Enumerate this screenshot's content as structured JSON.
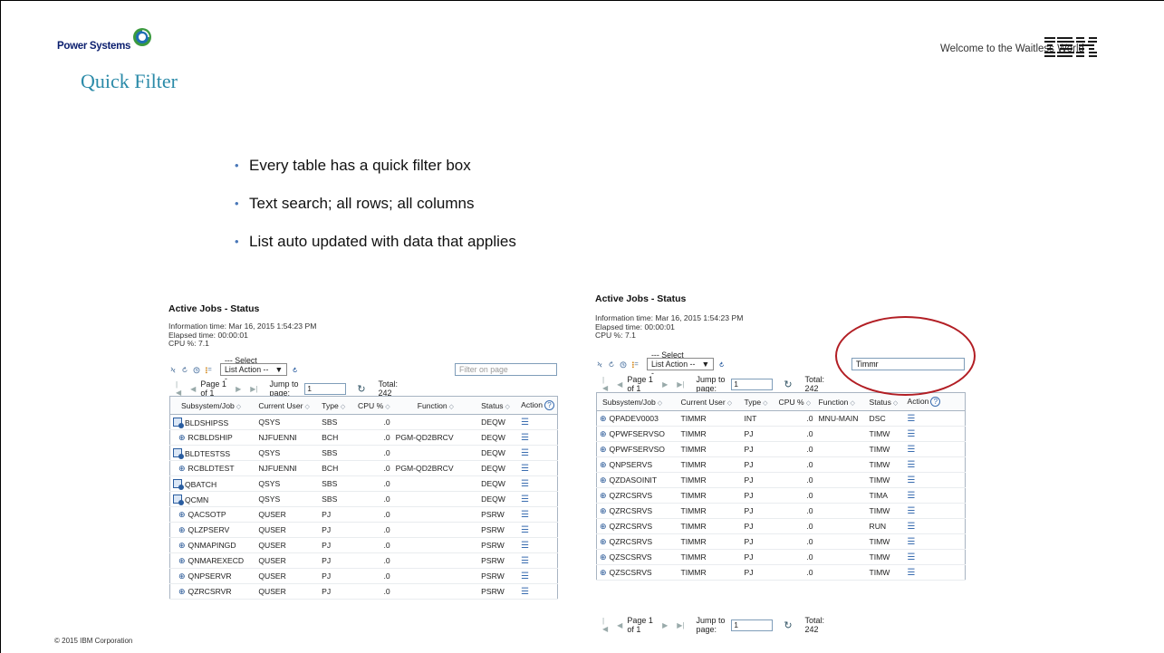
{
  "header": {
    "brand": "Power Systems",
    "title": "Quick Filter",
    "welcome": "Welcome to the Waitless World",
    "company_logo": "IBM"
  },
  "bullets": [
    "Every table has a quick filter box",
    "Text search; all rows; all columns",
    "List auto updated with data that applies"
  ],
  "footer": {
    "copyright": "© 2015 IBM Corporation"
  },
  "columns": [
    "Subsystem/Job",
    "Current User",
    "Type",
    "CPU %",
    "Function",
    "Status",
    "Action"
  ],
  "left_panel": {
    "title": "Active Jobs - Status",
    "info_time": "Information time: Mar 16, 2015 1:54:23 PM",
    "elapsed": "Elapsed time: 00:00:01",
    "cpu": "CPU %: 7.1",
    "select_action": "--- Select List Action ---",
    "filter_placeholder": "Filter on page",
    "page_label": "Page 1 of 1",
    "jump_label": "Jump to page:",
    "jump_value": "1",
    "total": "Total: 242",
    "rows": [
      {
        "job": "BLDSHIPSS",
        "user": "QSYS",
        "type": "SBS",
        "cpu": ".0",
        "func": "",
        "status": "DEQW",
        "sbs": true
      },
      {
        "job": "RCBLDSHIP",
        "user": "NJFUENNI",
        "type": "BCH",
        "cpu": ".0",
        "func": "PGM-QD2BRCV",
        "status": "DEQW",
        "sbs": false
      },
      {
        "job": "BLDTESTSS",
        "user": "QSYS",
        "type": "SBS",
        "cpu": ".0",
        "func": "",
        "status": "DEQW",
        "sbs": true
      },
      {
        "job": "RCBLDTEST",
        "user": "NJFUENNI",
        "type": "BCH",
        "cpu": ".0",
        "func": "PGM-QD2BRCV",
        "status": "DEQW",
        "sbs": false
      },
      {
        "job": "QBATCH",
        "user": "QSYS",
        "type": "SBS",
        "cpu": ".0",
        "func": "",
        "status": "DEQW",
        "sbs": true
      },
      {
        "job": "QCMN",
        "user": "QSYS",
        "type": "SBS",
        "cpu": ".0",
        "func": "",
        "status": "DEQW",
        "sbs": true
      },
      {
        "job": "QACSOTP",
        "user": "QUSER",
        "type": "PJ",
        "cpu": ".0",
        "func": "",
        "status": "PSRW",
        "sbs": false
      },
      {
        "job": "QLZPSERV",
        "user": "QUSER",
        "type": "PJ",
        "cpu": ".0",
        "func": "",
        "status": "PSRW",
        "sbs": false
      },
      {
        "job": "QNMAPINGD",
        "user": "QUSER",
        "type": "PJ",
        "cpu": ".0",
        "func": "",
        "status": "PSRW",
        "sbs": false
      },
      {
        "job": "QNMAREXECD",
        "user": "QUSER",
        "type": "PJ",
        "cpu": ".0",
        "func": "",
        "status": "PSRW",
        "sbs": false
      },
      {
        "job": "QNPSERVR",
        "user": "QUSER",
        "type": "PJ",
        "cpu": ".0",
        "func": "",
        "status": "PSRW",
        "sbs": false
      },
      {
        "job": "QZRCSRVR",
        "user": "QUSER",
        "type": "PJ",
        "cpu": ".0",
        "func": "",
        "status": "PSRW",
        "sbs": false
      }
    ]
  },
  "right_panel": {
    "title": "Active Jobs - Status",
    "info_time": "Information time: Mar 16, 2015 1:54:23 PM",
    "elapsed": "Elapsed time: 00:00:01",
    "cpu": "CPU %: 7.1",
    "select_action": "--- Select List Action ---",
    "filter_value": "Timmr",
    "page_label": "Page 1 of 1",
    "jump_label": "Jump to page:",
    "jump_value": "1",
    "total": "Total: 242",
    "rows": [
      {
        "job": "QPADEV0003",
        "user": "TIMMR",
        "type": "INT",
        "cpu": ".0",
        "func": "MNU-MAIN",
        "status": "DSC"
      },
      {
        "job": "QPWFSERVSO",
        "user": "TIMMR",
        "type": "PJ",
        "cpu": ".0",
        "func": "",
        "status": "TIMW"
      },
      {
        "job": "QPWFSERVSO",
        "user": "TIMMR",
        "type": "PJ",
        "cpu": ".0",
        "func": "",
        "status": "TIMW"
      },
      {
        "job": "QNPSERVS",
        "user": "TIMMR",
        "type": "PJ",
        "cpu": ".0",
        "func": "",
        "status": "TIMW"
      },
      {
        "job": "QZDASOINIT",
        "user": "TIMMR",
        "type": "PJ",
        "cpu": ".0",
        "func": "",
        "status": "TIMW"
      },
      {
        "job": "QZRCSRVS",
        "user": "TIMMR",
        "type": "PJ",
        "cpu": ".0",
        "func": "",
        "status": "TIMA"
      },
      {
        "job": "QZRCSRVS",
        "user": "TIMMR",
        "type": "PJ",
        "cpu": ".0",
        "func": "",
        "status": "TIMW"
      },
      {
        "job": "QZRCSRVS",
        "user": "TIMMR",
        "type": "PJ",
        "cpu": ".0",
        "func": "",
        "status": "RUN"
      },
      {
        "job": "QZRCSRVS",
        "user": "TIMMR",
        "type": "PJ",
        "cpu": ".0",
        "func": "",
        "status": "TIMW"
      },
      {
        "job": "QZSCSRVS",
        "user": "TIMMR",
        "type": "PJ",
        "cpu": ".0",
        "func": "",
        "status": "TIMW"
      },
      {
        "job": "QZSCSRVS",
        "user": "TIMMR",
        "type": "PJ",
        "cpu": ".0",
        "func": "",
        "status": "TIMW"
      }
    ]
  },
  "colors": {
    "title": "#2a8aa8",
    "bullet": "#4a78b8",
    "annotation": "#b21e24",
    "brand": "#0a1e6e"
  }
}
